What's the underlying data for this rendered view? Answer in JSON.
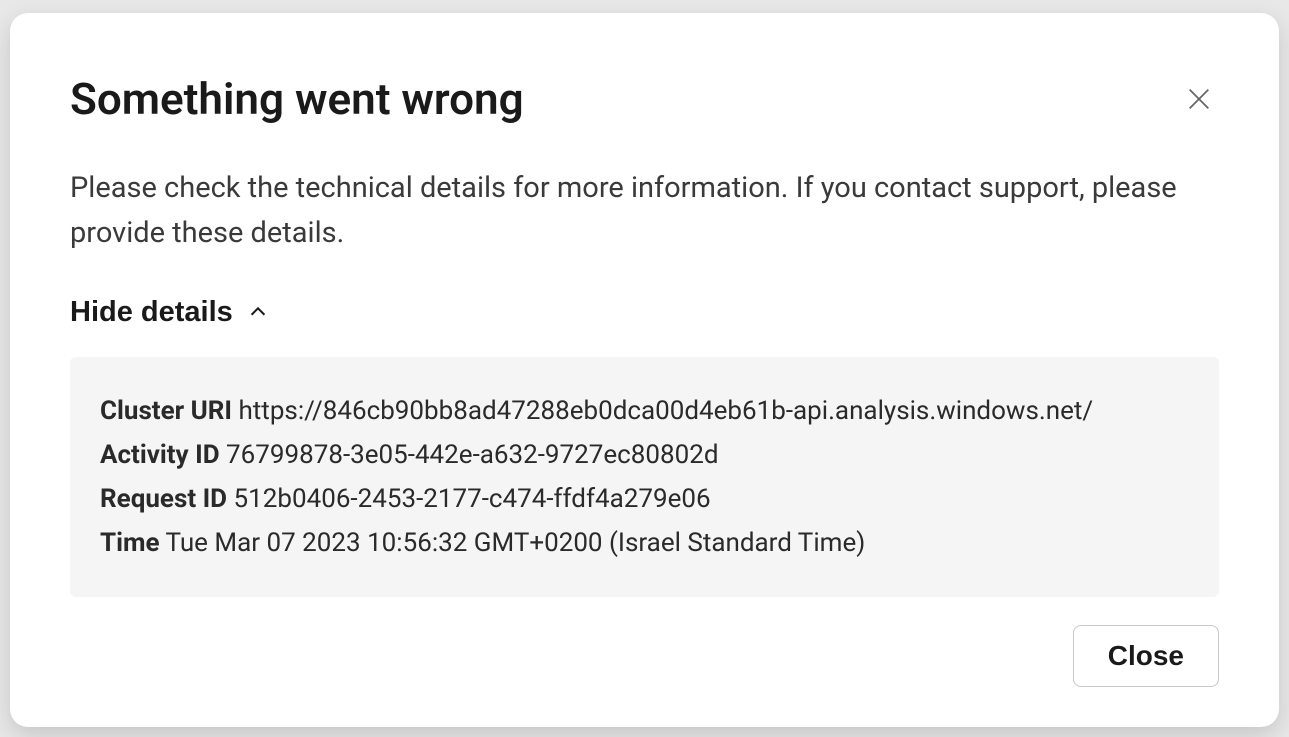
{
  "modal": {
    "title": "Something went wrong",
    "description": "Please check the technical details for more information. If you contact support, please provide these details.",
    "toggle_label": "Hide details",
    "details": {
      "cluster_uri_label": "Cluster URI",
      "cluster_uri_value": "https://846cb90bb8ad47288eb0dca00d4eb61b-api.analysis.windows.net/",
      "activity_id_label": "Activity ID",
      "activity_id_value": "76799878-3e05-442e-a632-9727ec80802d",
      "request_id_label": "Request ID",
      "request_id_value": "512b0406-2453-2177-c474-ffdf4a279e06",
      "time_label": "Time",
      "time_value": "Tue Mar 07 2023 10:56:32 GMT+0200 (Israel Standard Time)"
    },
    "close_button_label": "Close"
  }
}
